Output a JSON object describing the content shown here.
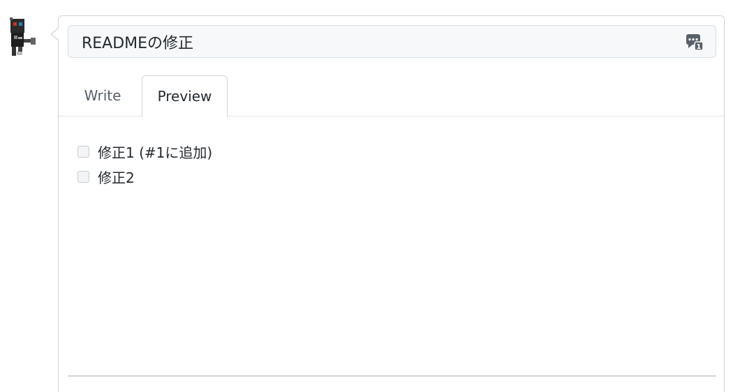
{
  "title_input": {
    "value": "READMEの修正"
  },
  "tabs": [
    {
      "label": "Write"
    },
    {
      "label": "Preview"
    }
  ],
  "active_tab": "Preview",
  "preview": {
    "tasks": [
      {
        "label": "修正1 (#1に追加)",
        "checked": false
      },
      {
        "label": "修正2",
        "checked": false
      }
    ]
  },
  "icons": {
    "avatar": "robot-avatar-icon",
    "saved_replies": "saved-replies-icon"
  },
  "colors": {
    "border": "#d1d5da",
    "input_bg": "#f6f8fa",
    "text": "#24292e",
    "muted_text": "#586069",
    "icon": "#586069"
  }
}
